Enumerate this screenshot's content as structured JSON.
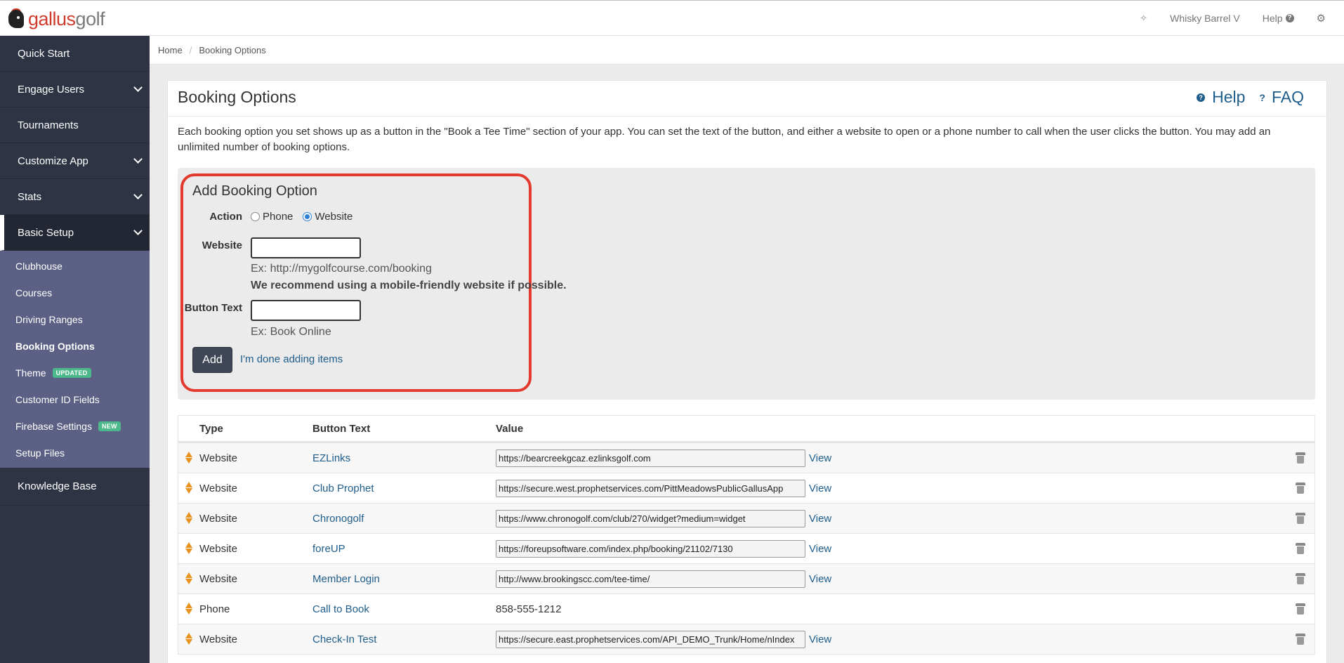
{
  "header": {
    "logo_left": "gallus",
    "logo_right": "golf",
    "wand_icon": "magic-wand-icon",
    "account": "Whisky Barrel V",
    "help": "Help",
    "help_icon": "?",
    "settings_icon": "gear-icon"
  },
  "sidebar": {
    "items": [
      {
        "label": "Quick Start",
        "has_children": false
      },
      {
        "label": "Engage Users",
        "has_children": true
      },
      {
        "label": "Tournaments",
        "has_children": false
      },
      {
        "label": "Customize App",
        "has_children": true
      },
      {
        "label": "Stats",
        "has_children": true
      },
      {
        "label": "Basic Setup",
        "has_children": true
      }
    ],
    "subitems": [
      {
        "label": "Clubhouse"
      },
      {
        "label": "Courses"
      },
      {
        "label": "Driving Ranges"
      },
      {
        "label": "Booking Options"
      },
      {
        "label": "Theme",
        "badge": "UPDATED"
      },
      {
        "label": "Customer ID Fields"
      },
      {
        "label": "Firebase Settings",
        "badge": "NEW"
      },
      {
        "label": "Setup Files"
      }
    ],
    "knowledge_base": "Knowledge Base"
  },
  "breadcrumb": {
    "home": "Home",
    "sep": "/",
    "current": "Booking Options"
  },
  "panel": {
    "title": "Booking Options",
    "help": "Help",
    "faq": "FAQ",
    "description": "Each booking option you set shows up as a button in the \"Book a Tee Time\" section of your app. You can set the text of the button, and either a website to open or a phone number to call when the user clicks the button. You may add an unlimited number of booking options."
  },
  "form": {
    "title": "Add Booking Option",
    "action_label": "Action",
    "option_phone": "Phone",
    "option_website": "Website",
    "selected": "Website",
    "website_label": "Website",
    "website_value": "",
    "website_hint": "Ex: http://mygolfcourse.com/booking",
    "website_recommend": "We recommend using a mobile-friendly website if possible.",
    "button_text_label": "Button Text",
    "button_text_value": "",
    "button_text_hint": "Ex: Book Online",
    "add_label": "Add",
    "done_label": "I'm done adding items"
  },
  "table": {
    "headers": {
      "type": "Type",
      "text": "Button Text",
      "value": "Value"
    },
    "view_label": "View",
    "rows": [
      {
        "type": "Website",
        "text": "EZLinks",
        "value": "https://bearcreekgcaz.ezlinksgolf.com"
      },
      {
        "type": "Website",
        "text": "Club Prophet",
        "value": "https://secure.west.prophetservices.com/PittMeadowsPublicGallusApp"
      },
      {
        "type": "Website",
        "text": "Chronogolf",
        "value": "https://www.chronogolf.com/club/270/widget?medium=widget"
      },
      {
        "type": "Website",
        "text": "foreUP",
        "value": "https://foreupsoftware.com/index.php/booking/21102/7130"
      },
      {
        "type": "Website",
        "text": "Member Login",
        "value": "http://www.brookingscc.com/tee-time/"
      },
      {
        "type": "Phone",
        "text": "Call to Book",
        "value": "858-555-1212"
      },
      {
        "type": "Website",
        "text": "Check-In Test",
        "value": "https://secure.east.prophetservices.com/API_DEMO_Trunk/Home/nIndex"
      }
    ]
  }
}
